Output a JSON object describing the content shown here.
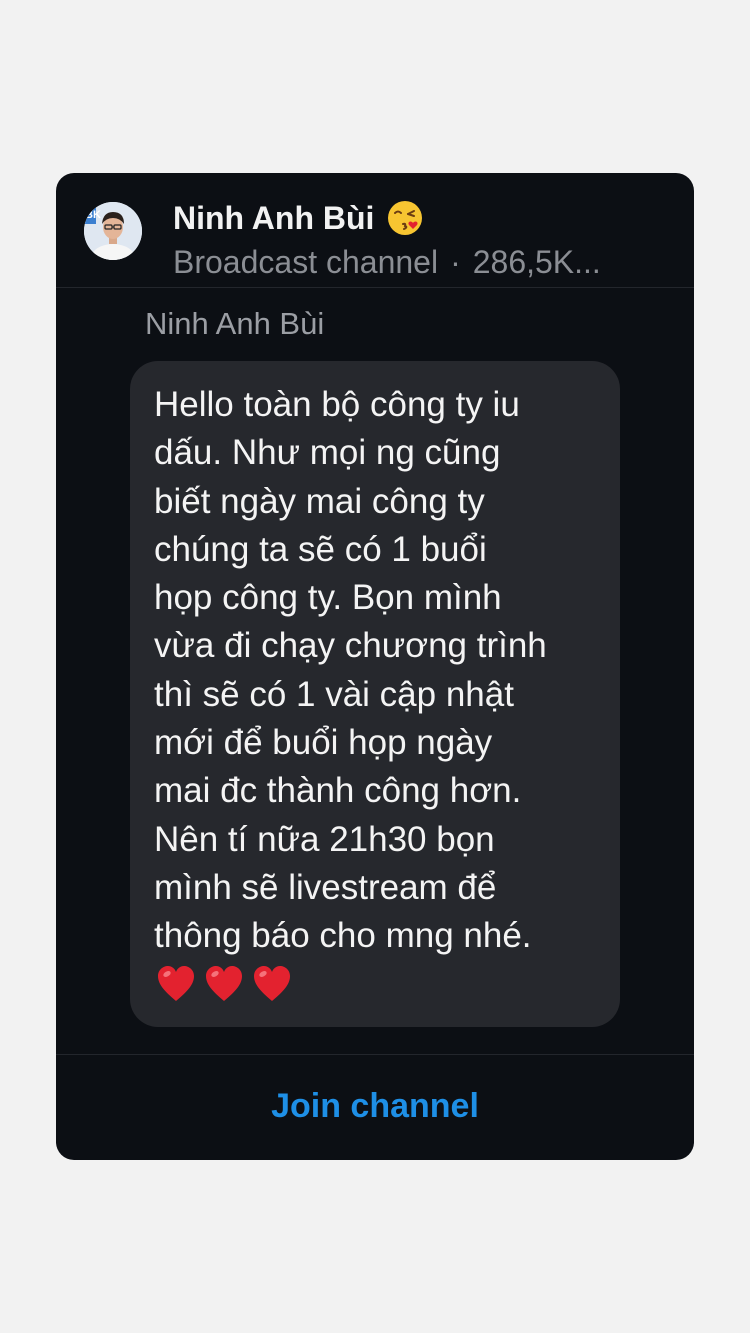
{
  "channel": {
    "name": "Ninh Anh Bùi",
    "name_emoji": "face-blowing-kiss-icon",
    "type_label": "Broadcast channel",
    "separator": "·",
    "followers": "286,5K..."
  },
  "message": {
    "sender": "Ninh Anh Bùi",
    "text": "Hello toàn bộ công ty iu\ndấu. Như mọi ng cũng\nbiết ngày mai công ty\nchúng ta sẽ có 1 buổi\nhọp công ty. Bọn mình\nvừa đi chạy chương trình\nthì sẽ có 1 vài cập nhật\nmới để buổi họp ngày\nmai đc thành công hơn.\nNên tí nữa 21h30 bọn\nmình sẽ livestream để\nthông báo cho mng nhé.",
    "hearts": [
      "red-heart-icon",
      "red-heart-icon",
      "red-heart-icon"
    ]
  },
  "footer": {
    "join_label": "Join channel"
  },
  "colors": {
    "page_bg": "#f2f2f2",
    "card_bg": "#0c0f14",
    "bubble_bg": "#26282d",
    "accent": "#1e8fe6",
    "heart": "#e3222f"
  }
}
